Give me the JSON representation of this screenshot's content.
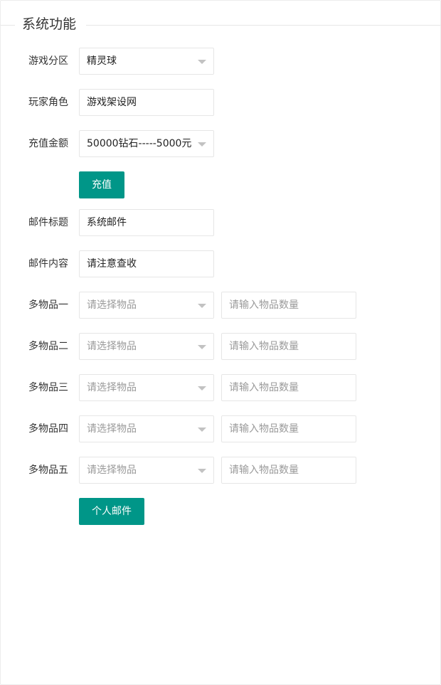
{
  "section_title": "系统功能",
  "form": {
    "game_zone": {
      "label": "游戏分区",
      "value": "精灵球"
    },
    "player_role": {
      "label": "玩家角色",
      "value": "游戏架设网"
    },
    "recharge_amount": {
      "label": "充值金额",
      "value": "50000钻石-----5000元"
    },
    "recharge_button": "充值",
    "mail_title": {
      "label": "邮件标题",
      "value": "系统邮件"
    },
    "mail_content": {
      "label": "邮件内容",
      "value": "请注意查收"
    },
    "items": [
      {
        "label": "多物品一",
        "select_placeholder": "请选择物品",
        "qty_placeholder": "请输入物品数量"
      },
      {
        "label": "多物品二",
        "select_placeholder": "请选择物品",
        "qty_placeholder": "请输入物品数量"
      },
      {
        "label": "多物品三",
        "select_placeholder": "请选择物品",
        "qty_placeholder": "请输入物品数量"
      },
      {
        "label": "多物品四",
        "select_placeholder": "请选择物品",
        "qty_placeholder": "请输入物品数量"
      },
      {
        "label": "多物品五",
        "select_placeholder": "请选择物品",
        "qty_placeholder": "请输入物品数量"
      }
    ],
    "personal_mail_button": "个人邮件"
  },
  "colors": {
    "primary_button": "#009688",
    "border": "#e6e6e6",
    "placeholder": "#9a9a9a"
  }
}
